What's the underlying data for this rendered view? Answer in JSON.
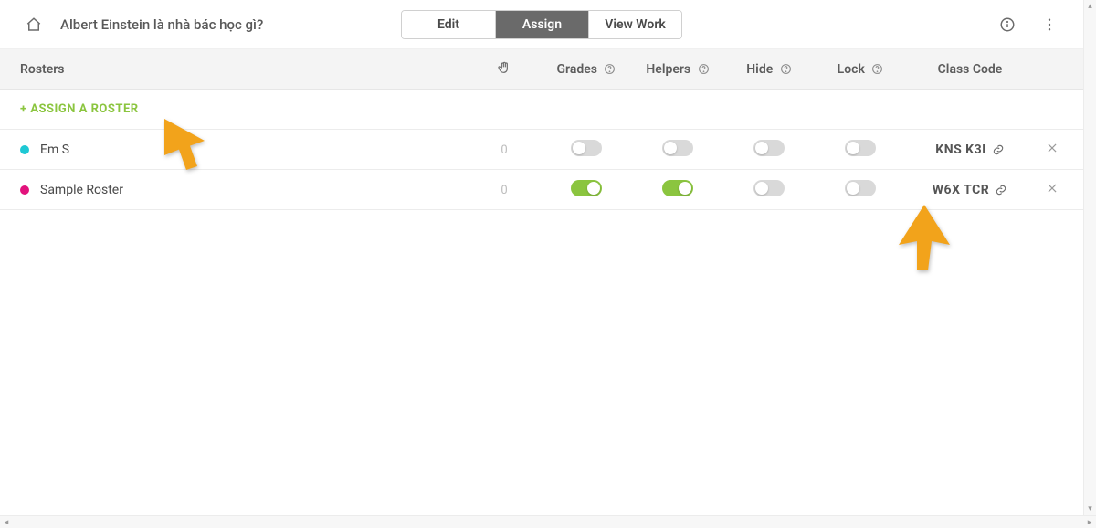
{
  "header": {
    "title": "Albert Einstein là nhà bác học gì?",
    "tabs": {
      "edit": "Edit",
      "assign": "Assign",
      "view_work": "View Work"
    },
    "active_tab": "assign"
  },
  "columns": {
    "rosters": "Rosters",
    "grades": "Grades",
    "helpers": "Helpers",
    "hide": "Hide",
    "lock": "Lock",
    "class_code": "Class Code"
  },
  "assign_roster_label": "+ ASSIGN A ROSTER",
  "rosters": [
    {
      "name": "Em S",
      "color": "#1ec8d4",
      "count": "0",
      "grades_on": false,
      "helpers_on": false,
      "hide_on": false,
      "lock_on": false,
      "class_code": "KNS K3I"
    },
    {
      "name": "Sample Roster",
      "color": "#e2127c",
      "count": "0",
      "grades_on": true,
      "helpers_on": true,
      "hide_on": false,
      "lock_on": false,
      "class_code": "W6X TCR"
    }
  ],
  "colors": {
    "accent_green": "#8bc53f",
    "arrow": "#f2a31b"
  }
}
